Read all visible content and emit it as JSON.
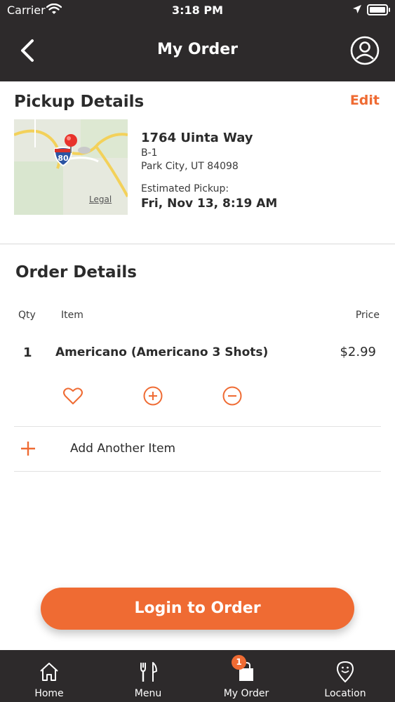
{
  "status_bar": {
    "carrier": "Carrier",
    "time": "3:18 PM"
  },
  "header": {
    "title": "My Order"
  },
  "pickup": {
    "title": "Pickup Details",
    "edit_label": "Edit",
    "map_legal": "Legal",
    "map_shield": "80",
    "address_line1": "1764 Uinta Way",
    "address_line2": "B-1",
    "address_line3": "Park City, UT 84098",
    "estimated_label": "Estimated Pickup:",
    "estimated_value": "Fri, Nov 13, 8:19 AM"
  },
  "order": {
    "title": "Order Details",
    "columns": {
      "qty": "Qty",
      "item": "Item",
      "price": "Price"
    },
    "items": [
      {
        "qty": "1",
        "name": "Americano (Americano 3 Shots)",
        "price": "$2.99"
      }
    ],
    "add_item_label": "Add Another Item"
  },
  "cta": {
    "label": "Login to Order"
  },
  "tabs": [
    {
      "label": "Home",
      "icon": "home-icon"
    },
    {
      "label": "Menu",
      "icon": "fork-knife-icon"
    },
    {
      "label": "My Order",
      "icon": "bag-icon",
      "badge": "1"
    },
    {
      "label": "Location",
      "icon": "location-pin-icon"
    }
  ],
  "colors": {
    "accent": "#ef6b33",
    "header_bg": "#2d2a2b"
  }
}
